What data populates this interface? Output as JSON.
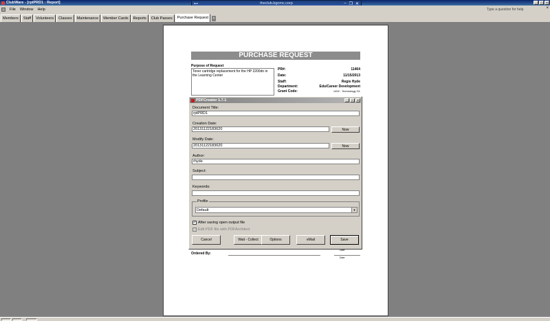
{
  "window": {
    "title": "ClubWare - [rptPRD1 : Report]"
  },
  "rdp": {
    "host": "theclub.bgcmc.corp"
  },
  "menu": {
    "items": [
      "File",
      "Window",
      "Help"
    ],
    "help_placeholder": "Type a question for help"
  },
  "tabs": [
    "Members",
    "Staff",
    "Volunteers",
    "Classes",
    "Maintenance",
    "Member Cards",
    "Reports",
    "Club Passes",
    "Purchase Request"
  ],
  "report": {
    "header": "PURCHASE REQUEST",
    "purpose_label": "Purpose of Request",
    "purpose_text": "Toner cartridge replacement for the HP 2200dn in the Learning Center",
    "fields": [
      {
        "label": "PR#:",
        "value": "11464"
      },
      {
        "label": "Date:",
        "value": "11/15/2013"
      },
      {
        "label": "Staff:",
        "value": "Regis Hyde"
      },
      {
        "label": "Department:",
        "value": "Edu/Career Development"
      },
      {
        "label": "Grant Code:",
        "value": "1492 - Technology G1"
      }
    ],
    "ordered_by_label": "Ordered By:",
    "sig_caption_1": "Date",
    "sig_caption_2": "Date"
  },
  "dialog": {
    "title": "PDFCreator 1.7.1",
    "document_title_label": "Document Title:",
    "document_title_value": "rptPRD1",
    "creation_date_label": "Creation Date:",
    "creation_date_value": "20131122183620",
    "modify_date_label": "Modify Date:",
    "modify_date_value": "20131122183620",
    "now_label": "Now",
    "author_label": "Author:",
    "author_value": "rhyde",
    "subject_label": "Subject:",
    "subject_value": "",
    "keywords_label": "Keywords:",
    "keywords_value": "",
    "profile_label": "Profile",
    "profile_value": "Default",
    "after_saving_label": "After saving open output file",
    "after_saving_checked": true,
    "edit_pdf_label": "Edit PDF file with PDFArchitect",
    "edit_pdf_checked": false,
    "buttons": {
      "cancel": "Cancel",
      "wait_collect": "Wait - Collect",
      "options": "Options",
      "email": "eMail",
      "save": "Save"
    }
  }
}
